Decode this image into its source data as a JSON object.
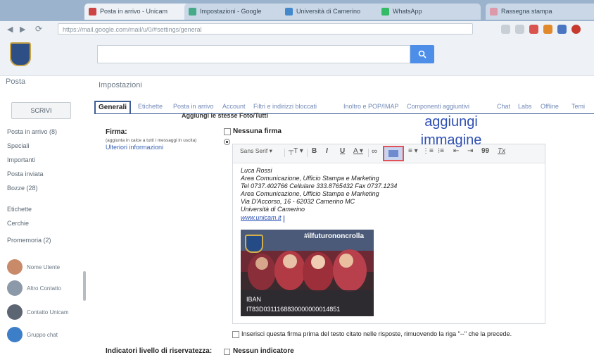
{
  "browser": {
    "tabs": [
      {
        "label": "Posta in arrivo - Unicam",
        "fav": "#c44"
      },
      {
        "label": "Impostazioni - Google",
        "fav": "#4a8"
      },
      {
        "label": "Università di Camerino",
        "fav": "#48c"
      },
      {
        "label": "WhatsApp",
        "fav": "#3b6"
      },
      {
        "label": "Rassegna stampa",
        "fav": "#d9a"
      }
    ],
    "url": "https://mail.google.com/mail/u/0/#settings/general"
  },
  "gmail": {
    "app_title": "Posta",
    "settings_title": "Impostazioni",
    "compose_label": "SCRIVI",
    "sidebar": [
      "Posta in arrivo (8)",
      "Speciali",
      "Importanti",
      "Posta inviata",
      "Bozze (28)",
      "Etichette",
      "Cerchie",
      "Promemoria (2)"
    ],
    "chats": [
      "Nome Utente",
      "Altro Contatto",
      "Contatto Unicam",
      "Gruppo chat"
    ],
    "tabs": {
      "active": "Generali",
      "others": [
        "Etichette",
        "Posta in arrivo",
        "Account",
        "Filtri e indirizzi bloccati",
        "Inoltro e POP/IMAP",
        "Componenti aggiuntivi",
        "Chat",
        "Labs",
        "Offline",
        "Temi"
      ],
      "partial_row": "Aggiungi le stesse Foto/Tutti"
    }
  },
  "signature": {
    "label": "Firma:",
    "sub_label": "(aggiunta in calce a tutti i messaggi in uscita)",
    "more_info": "Ulteriori informazioni",
    "none_option": "Nessuna firma",
    "toolbar": {
      "font": "Sans Serif",
      "size": "T",
      "bold": "B",
      "italic": "I",
      "underline": "U",
      "text_color": "A",
      "link": "∞",
      "align": "≡",
      "numbered": "⋮≡",
      "bulleted": "⁝≡",
      "indent_less": "⇤",
      "indent_more": "⇥",
      "quote": "99",
      "clear": "Tx"
    },
    "lines": [
      "Luca Rossi",
      "Area Comunicazione, Ufficio Stampa e Marketing",
      "Tel 0737.402766  Cellulare 333.8765432   Fax 0737.1234",
      "Area Comunicazione, Ufficio Stampa e Marketing",
      "Via D'Accorso, 16 - 62032 Camerino MC",
      "Università di Camerino"
    ],
    "url": "www.unicam.it",
    "image": {
      "hashtag": "#ilfuturononcrolla",
      "iban_label": "IBAN",
      "iban_code": "IT83D0311168830000000014851"
    },
    "insert_before_quote": "Inserisci questa firma prima del testo citato nelle risposte, rimuovendo la riga \"--\" che la precede."
  },
  "confidentiality": {
    "label": "Indicatori livello di riservatezza:",
    "value": "Nessun indicatore"
  },
  "annotation": {
    "text": "aggiungi immagine",
    "color": "#2e4fb3"
  }
}
